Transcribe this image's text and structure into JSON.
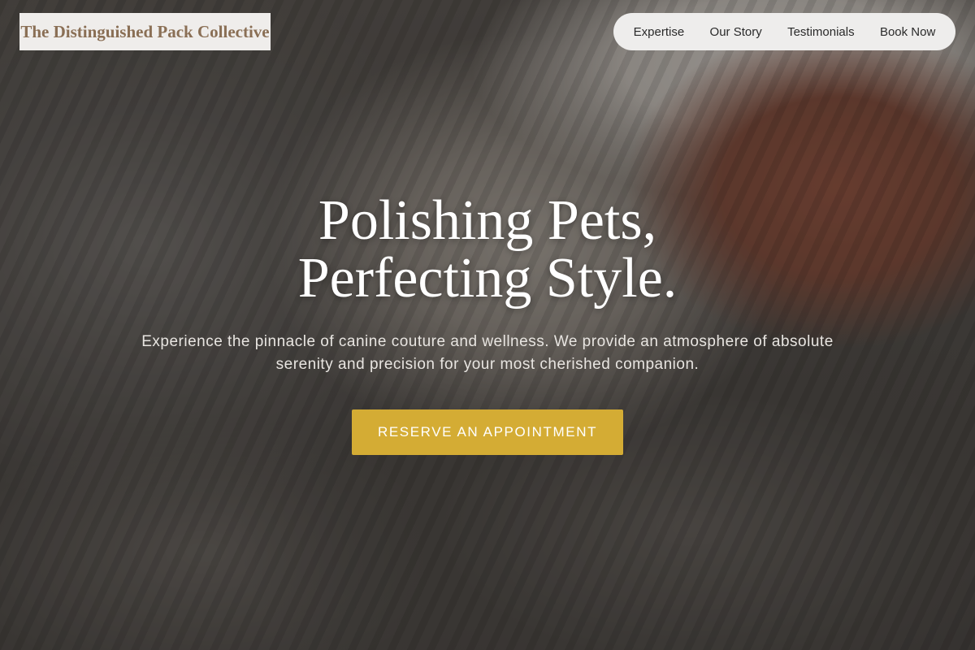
{
  "header": {
    "brand": "The Distinguished Pack Collective",
    "nav": [
      {
        "label": "Expertise"
      },
      {
        "label": "Our Story"
      },
      {
        "label": "Testimonials"
      },
      {
        "label": "Book Now"
      }
    ]
  },
  "hero": {
    "title_line1": "Polishing Pets,",
    "title_line2": "Perfecting Style.",
    "subtitle": "Experience the pinnacle of canine couture and wellness. We provide an atmosphere of absolute serenity and precision for your most cherished companion.",
    "cta_label": "RESERVE AN APPOINTMENT"
  },
  "colors": {
    "accent": "#d4ac34",
    "brand_text": "#8a6f55",
    "header_bg": "#eeedec"
  }
}
